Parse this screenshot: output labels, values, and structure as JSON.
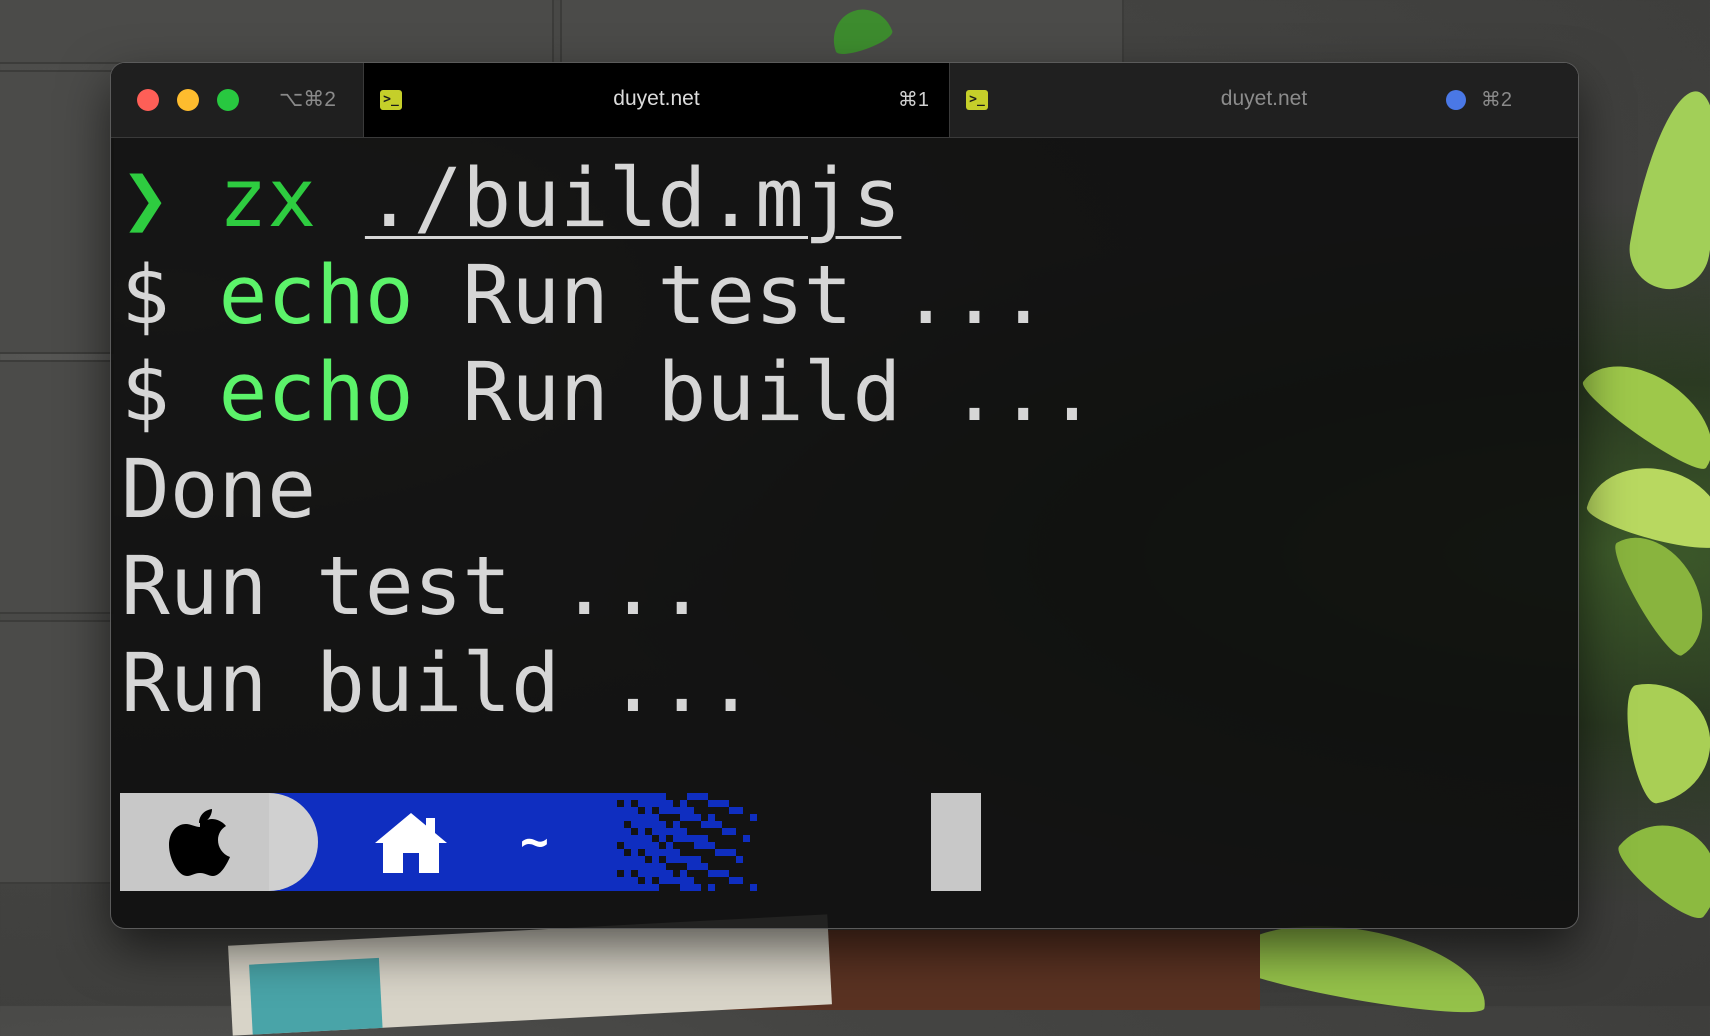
{
  "window": {
    "shortcut": "⌥⌘2",
    "traffic_lights": [
      "close",
      "minimize",
      "maximize"
    ]
  },
  "tabs": [
    {
      "title": "duyet.net",
      "shortcut": "⌘1",
      "active": true,
      "icon": "terminal-icon"
    },
    {
      "title": "duyet.net",
      "shortcut": "⌘2",
      "active": false,
      "icon": "terminal-icon",
      "status_dot_color": "#4a78e6"
    }
  ],
  "terminal": {
    "lines": [
      {
        "prompt": "❯",
        "command": "zx",
        "arg": "./build.mjs"
      },
      {
        "prefix": "$",
        "command": "echo",
        "rest": "Run test ..."
      },
      {
        "prefix": "$",
        "command": "echo",
        "rest": "Run build ..."
      },
      {
        "text": "Done"
      },
      {
        "text": "Run test ..."
      },
      {
        "text": "Run build ..."
      }
    ],
    "powerline": {
      "os_icon": "apple-logo-icon",
      "home_icon": "home-icon",
      "directory": "~",
      "segment_color": "#0f2ec0",
      "os_segment_color": "#c8c8c8"
    },
    "colors": {
      "command": "#2ecc40",
      "echo": "#5cf36a",
      "text": "#d6d6d6"
    }
  }
}
